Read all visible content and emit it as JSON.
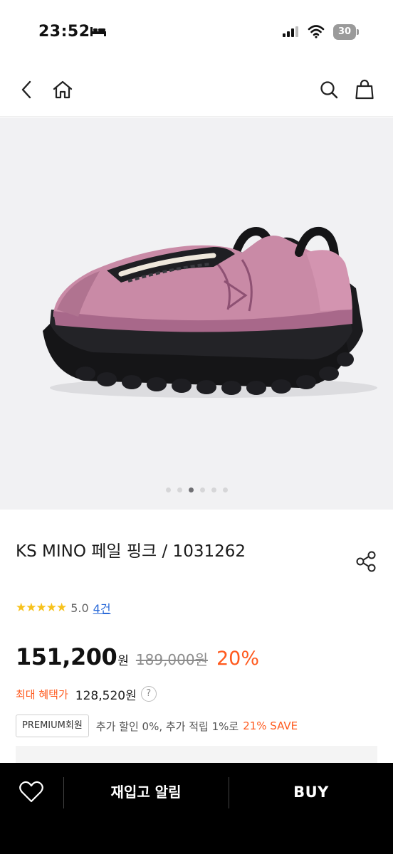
{
  "status_bar": {
    "time": "23:52",
    "battery": "30"
  },
  "nav": {
    "back_icon": "chevron-left-icon",
    "home_icon": "home-icon",
    "search_icon": "search-icon",
    "bag_icon": "shopping-bag-icon"
  },
  "gallery": {
    "image_count": 6,
    "active_index": 2
  },
  "product": {
    "title": "KS MINO 페일 핑크 / 1031262",
    "rating": {
      "stars": "★★★★★",
      "score": "5.0",
      "review_count": "4건"
    },
    "price": {
      "current": "151,200",
      "unit": "원",
      "original": "189,000원",
      "discount": "20%"
    },
    "max_benefit": {
      "label": "최대 혜택가",
      "value": "128,520원",
      "help": "?"
    },
    "membership": {
      "badge": "PREMIUM회원",
      "text": "추가 할인 0%, 추가 적립 1%로",
      "save": "21% SAVE"
    }
  },
  "bottom_bar": {
    "restock_label": "재입고 알림",
    "buy_label": "BUY"
  },
  "colors": {
    "accent": "#ff5a1e",
    "star": "#f7c21c",
    "link": "#2a6ad8",
    "shoe_pink": "#c98aa6"
  }
}
